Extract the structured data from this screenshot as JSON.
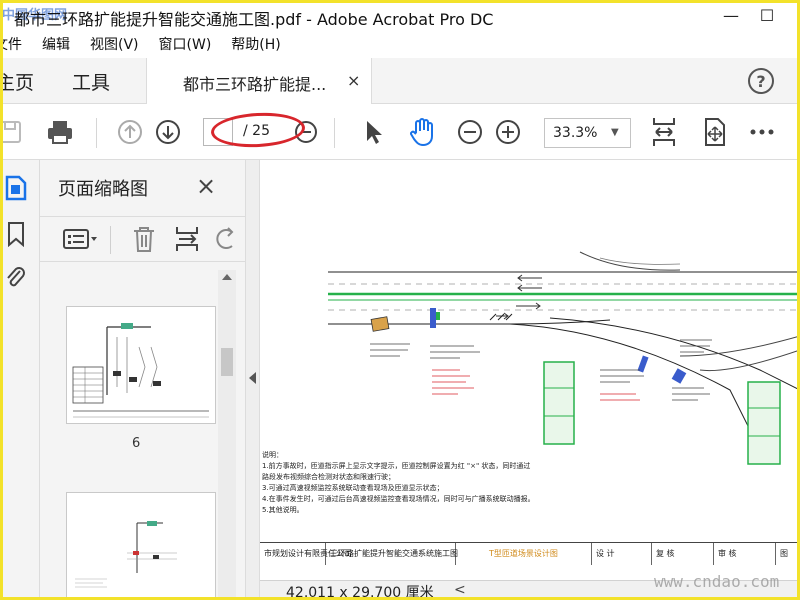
{
  "window": {
    "title": "都市三环路扩能提升智能交通施工图.pdf - Adobe Acrobat Pro DC",
    "watermark_top_left": "中国华图网",
    "minimize_glyph": "—",
    "maximize_glyph": "☐"
  },
  "menu": {
    "items": [
      "文件",
      "编辑",
      "视图(V)",
      "窗口(W)",
      "帮助(H)"
    ]
  },
  "tabs": {
    "home": "主页",
    "tools": "工具",
    "doc_label": "都市三环路扩能提...",
    "close_glyph": "×",
    "help_glyph": "?"
  },
  "toolbar": {
    "page_current": "",
    "page_total": "/ 25",
    "zoom": "33.3%",
    "zoom_caret": "▼",
    "icons": [
      "save-icon",
      "print-icon",
      "page-up-icon",
      "page-down-icon",
      "zoom-out-icon",
      "select-arrow-icon",
      "hand-tool-icon",
      "zoom-out-icon",
      "zoom-in-icon",
      "fit-page-icon",
      "fullscreen-icon",
      "more-icon"
    ]
  },
  "thumbnails": {
    "title": "页面缩略图",
    "close_glyph": "×",
    "page_label": "6"
  },
  "document": {
    "notes_title": "说明：",
    "notes": [
      "1.前方事故时，匝道指示屏上显示文字提示，匝道控制屏设置为红 \"×\" 状态，同时通过",
      "  路段发布视频综合检测对状态和限速行驶；",
      "3.可通过高速视频监控系统联动查看现场及匝道显示状态；",
      "4.在事件发生时，可通过后台高速视频监控查看现场情况，同时可与广播系统联动播报。",
      "5.其他说明。"
    ],
    "title_block": {
      "company": "市规划设计有限责任公司",
      "project": "三环路扩能提升智能交通系统施工图",
      "drawing": "T型匝道场景设计图",
      "design": "设 计",
      "review": "复 核",
      "approve": "审 核",
      "fig": "图"
    }
  },
  "status": {
    "page_size": "42.011 x 29.700 厘米",
    "scroll_left_glyph": "<"
  },
  "watermark_bottom_right": "www.cndao.com",
  "colors": {
    "accent_blue": "#1a73e8",
    "annotation_red": "#d8262c",
    "road_green": "#26b14a",
    "frame_yellow": "#f3e22a"
  }
}
